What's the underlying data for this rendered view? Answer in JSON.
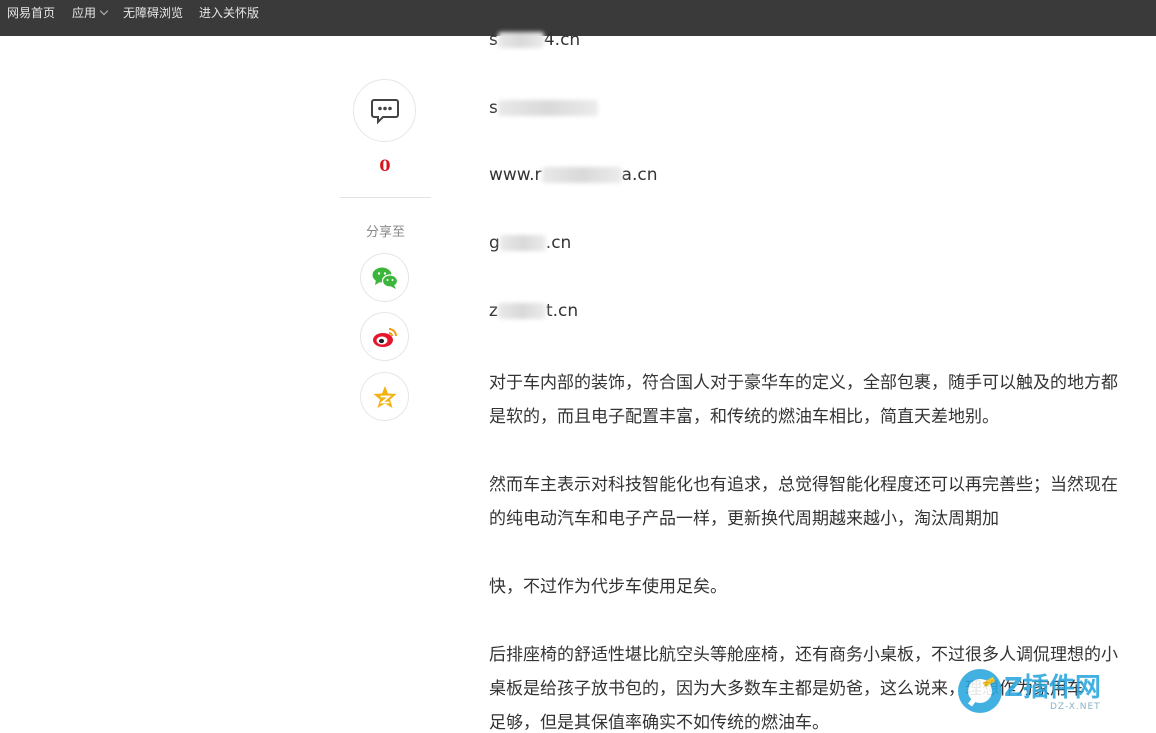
{
  "topbar": {
    "home": "网易首页",
    "apps": "应用",
    "accessible": "无障碍浏览",
    "care_mode": "进入关怀版"
  },
  "rail": {
    "comment_count": "0",
    "share_label": "分享至",
    "icons": [
      "comment-icon",
      "wechat-icon",
      "weibo-icon",
      "qzone-icon"
    ]
  },
  "article": {
    "domains": [
      {
        "prefix": "s",
        "suffix": "4.cn"
      },
      {
        "prefix": "s",
        "suffix": ""
      },
      {
        "prefix": "www.r",
        "suffix": "a.cn"
      },
      {
        "prefix": "g",
        "suffix": ".cn"
      },
      {
        "prefix": "z",
        "suffix": "t.cn"
      }
    ],
    "lines": [
      "对于车内部的装饰，符合国人对于豪华车的定义，全部包裹，随手可以触及的地方都",
      "是软的，而且电子配置丰富，和传统的燃油车相比，简直天差地别。",
      "然而车主表示对科技智能化也有追求，总觉得智能化程度还可以再完善些；当然现在",
      "的纯电动汽车和电子产品一样，更新换代周期越来越小，淘汰周期加",
      "快，不过作为代步车使用足矣。",
      "后排座椅的舒适性堪比航空头等舱座椅，还有商务小桌板，不过很多人调侃理想的小",
      "桌板是给孩子放书包的，因为大多数车主都是奶爸，这么说来，理想作为家用车",
      "足够，但是其保值率确实不如传统的燃油车。"
    ]
  },
  "watermark": {
    "text": "Z插件网",
    "sub": "DZ-X.NET"
  },
  "colors": {
    "topbar": "#3a3a3a",
    "comment_count": "#d8141c",
    "wechat": "#3bb53a",
    "weibo": "#e6162d",
    "qzone": "#f2b20f",
    "watermark": "#2aa6df"
  }
}
